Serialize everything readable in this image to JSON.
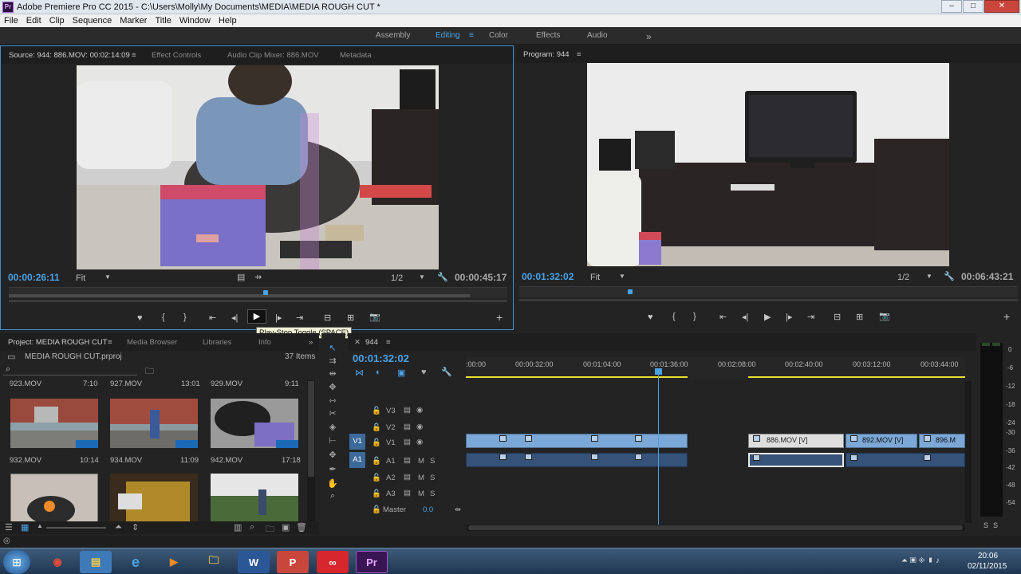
{
  "window": {
    "title": "Adobe Premiere Pro CC 2015 - C:\\Users\\Molly\\My Documents\\MEDIA\\MEDIA ROUGH CUT *",
    "logo": "Pr"
  },
  "menu": [
    "File",
    "Edit",
    "Clip",
    "Sequence",
    "Marker",
    "Title",
    "Window",
    "Help"
  ],
  "workspaces": {
    "items": [
      "Assembly",
      "Editing",
      "Color",
      "Effects",
      "Audio"
    ],
    "active": "Editing",
    "more": "»"
  },
  "source": {
    "tabs": [
      "Source: 944: 886.MOV: 00:02:14:09",
      "Effect Controls",
      "Audio Clip Mixer: 886.MOV",
      "Metadata"
    ],
    "timecode": "00:00:26:11",
    "fit": "Fit",
    "resolution": "1/2",
    "duration": "00:00:45:17"
  },
  "program": {
    "tab": "Program: 944",
    "timecode": "00:01:32:02",
    "fit": "Fit",
    "resolution": "1/2",
    "duration": "00:06:43:21"
  },
  "tooltip": "Play-Stop Toggle (SPACE)",
  "project": {
    "tabs": [
      "Project: MEDIA ROUGH CUT",
      "Media Browser",
      "Libraries",
      "Info"
    ],
    "file": "MEDIA ROUGH CUT.prproj",
    "count": "37 Items",
    "clips": [
      {
        "name": "923.MOV",
        "dur": "7:10"
      },
      {
        "name": "927.MOV",
        "dur": "13:01"
      },
      {
        "name": "929.MOV",
        "dur": "9:11"
      },
      {
        "name": "932.MOV",
        "dur": "10:14"
      },
      {
        "name": "934.MOV",
        "dur": "11:09"
      },
      {
        "name": "942.MOV",
        "dur": "17:18"
      }
    ]
  },
  "timeline": {
    "tab": "944",
    "timecode": "00:01:32:02",
    "ruler": [
      ":00:00",
      "00:00:32:00",
      "00:01:04:00",
      "00:01:36:00",
      "00:02:08:00",
      "00:02:40:00",
      "00:03:12:00",
      "00:03:44:00"
    ],
    "tracks": [
      {
        "id": "V3",
        "label": "V3"
      },
      {
        "id": "V2",
        "label": "V2"
      },
      {
        "id": "V1",
        "label": "V1",
        "src": "V1"
      },
      {
        "id": "A1",
        "label": "A1",
        "src": "A1"
      },
      {
        "id": "A2",
        "label": "A2"
      },
      {
        "id": "A3",
        "label": "A3"
      }
    ],
    "master_label": "Master",
    "master_value": "0.0",
    "clips": [
      "886.MOV [V]",
      "892.MOV [V]",
      "896.M"
    ],
    "playhead_progress": 0.385
  },
  "meter": {
    "scale": [
      "0",
      "-6",
      "-12",
      "-18",
      "-24",
      "-30",
      "-36",
      "-42",
      "-48",
      "-54"
    ],
    "channels": [
      "S",
      "S"
    ]
  },
  "taskbar": {
    "apps": [
      "Chrome",
      "Explorer",
      "IE",
      "Media Player",
      "Folder",
      "W",
      "P",
      "Creative Cloud",
      "Pr"
    ],
    "time": "20:06",
    "date": "02/11/2015"
  }
}
